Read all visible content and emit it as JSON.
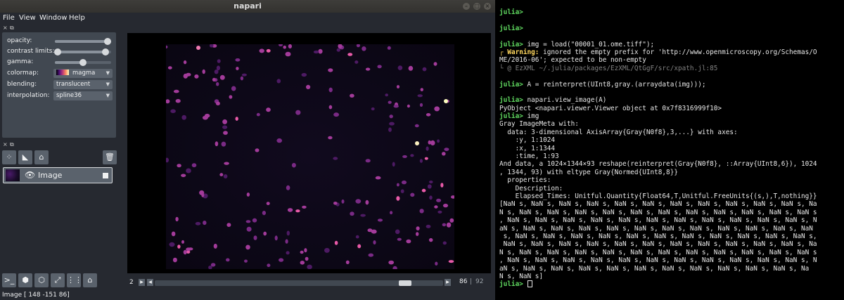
{
  "napari": {
    "title": "napari",
    "menu": [
      "File",
      "View",
      "Window",
      "Help"
    ],
    "controls": {
      "opacity_label": "opacity:",
      "opacity_value": 1.0,
      "contrast_label": "contrast limits:",
      "contrast_range": [
        0.03,
        0.9
      ],
      "gamma_label": "gamma:",
      "gamma_value": 0.5,
      "colormap_label": "colormap:",
      "colormap_value": "magma",
      "blending_label": "blending:",
      "blending_value": "translucent",
      "interpolation_label": "interpolation:",
      "interpolation_value": "spline36"
    },
    "layer": {
      "name": "Image",
      "visible": true
    },
    "tool_icons": [
      "add-points-icon",
      "add-shapes-icon",
      "add-labels-icon",
      "delete-layer-icon"
    ],
    "bottom_icons": [
      "console-icon",
      "ndisplay-icon",
      "roll-icon",
      "transpose-icon",
      "grid-icon",
      "home-icon"
    ],
    "dims": {
      "left_label": "2",
      "current": "86",
      "max": "92",
      "position_fraction": 0.92
    },
    "status": "Image [ 148 -151   86]"
  },
  "colors": {
    "napari_bg": "#262930",
    "panel": "#414851",
    "control": "#5a626c",
    "prompt": "#5fd75f",
    "warning": "#ffd75f"
  },
  "terminal": {
    "lines": [
      {
        "prompt": "julia>",
        "text": ""
      },
      {
        "prompt": "",
        "text": ""
      },
      {
        "prompt": "julia>",
        "text": ""
      },
      {
        "prompt": "",
        "text": ""
      },
      {
        "prompt": "julia>",
        "text": " img = load(\"00001_01.ome.tiff\");"
      },
      {
        "prefix": "┌ ",
        "warn": "Warning:",
        "text": " ignored the empty prefix for 'http://www.openmicroscopy.org/Schemas/O"
      },
      {
        "text": "ME/2016-06'; expected to be non-empty"
      },
      {
        "dim": "└ @ EzXML ~/.julia/packages/EzXML/QtGgF/src/xpath.jl:85"
      },
      {
        "text": ""
      },
      {
        "prompt": "julia>",
        "text": " A = reinterpret(UInt8,gray.(arraydata(img)));"
      },
      {
        "text": ""
      },
      {
        "prompt": "julia>",
        "text": " napari.view_image(A)"
      },
      {
        "text": "PyObject <napari.viewer.Viewer object at 0x7f8316999f10>"
      },
      {
        "prompt": "julia>",
        "text": " img"
      },
      {
        "text": "Gray ImageMeta with:"
      },
      {
        "text": "  data: 3-dimensional AxisArray{Gray{N0f8},3,...} with axes:"
      },
      {
        "text": "    :y, 1:1024"
      },
      {
        "text": "    :x, 1:1344"
      },
      {
        "text": "    :time, 1:93"
      },
      {
        "text": "And data, a 1024×1344×93 reshape(reinterpret(Gray{N0f8}, ::Array{UInt8,6}), 1024"
      },
      {
        "text": ", 1344, 93) with eltype Gray{Normed{UInt8,8}}"
      },
      {
        "text": "  properties:"
      },
      {
        "text": "    Description:"
      },
      {
        "text": "    Elapsed_Times: Unitful.Quantity{Float64,T,Unitful.FreeUnits{(s,),T,nothing}}"
      },
      {
        "text": "[NaN s, NaN s, NaN s, NaN s, NaN s, NaN s, NaN s, NaN s, NaN s, NaN s, NaN s, Na"
      },
      {
        "text": "N s, NaN s, NaN s, NaN s, NaN s, NaN s, NaN s, NaN s, NaN s, NaN s, NaN s, NaN s"
      },
      {
        "text": ", NaN s, NaN s, NaN s, NaN s, NaN s, NaN s, NaN s, NaN s, NaN s, NaN s, NaN s, N"
      },
      {
        "text": "aN s, NaN s, NaN s, NaN s, NaN s, NaN s, NaN s, NaN s, NaN s, NaN s, NaN s, NaN"
      },
      {
        "text": " s, NaN s, NaN s, NaN s, NaN s, NaN s, NaN s, NaN s, NaN s, NaN s, NaN s, NaN s,"
      },
      {
        "text": " NaN s, NaN s, NaN s, NaN s, NaN s, NaN s, NaN s, NaN s, NaN s, NaN s, NaN s, Na"
      },
      {
        "text": "N s, NaN s, NaN s, NaN s, NaN s, NaN s, NaN s, NaN s, NaN s, NaN s, NaN s, NaN s"
      },
      {
        "text": ", NaN s, NaN s, NaN s, NaN s, NaN s, NaN s, NaN s, NaN s, NaN s, NaN s, NaN s, N"
      },
      {
        "text": "aN s, NaN s, NaN s, NaN s, NaN s, NaN s, NaN s, NaN s, NaN s, NaN s, NaN s, Na"
      },
      {
        "text": "N s, NaN s]"
      },
      {
        "prompt": "julia>",
        "text": " ",
        "cursor": true
      }
    ]
  }
}
